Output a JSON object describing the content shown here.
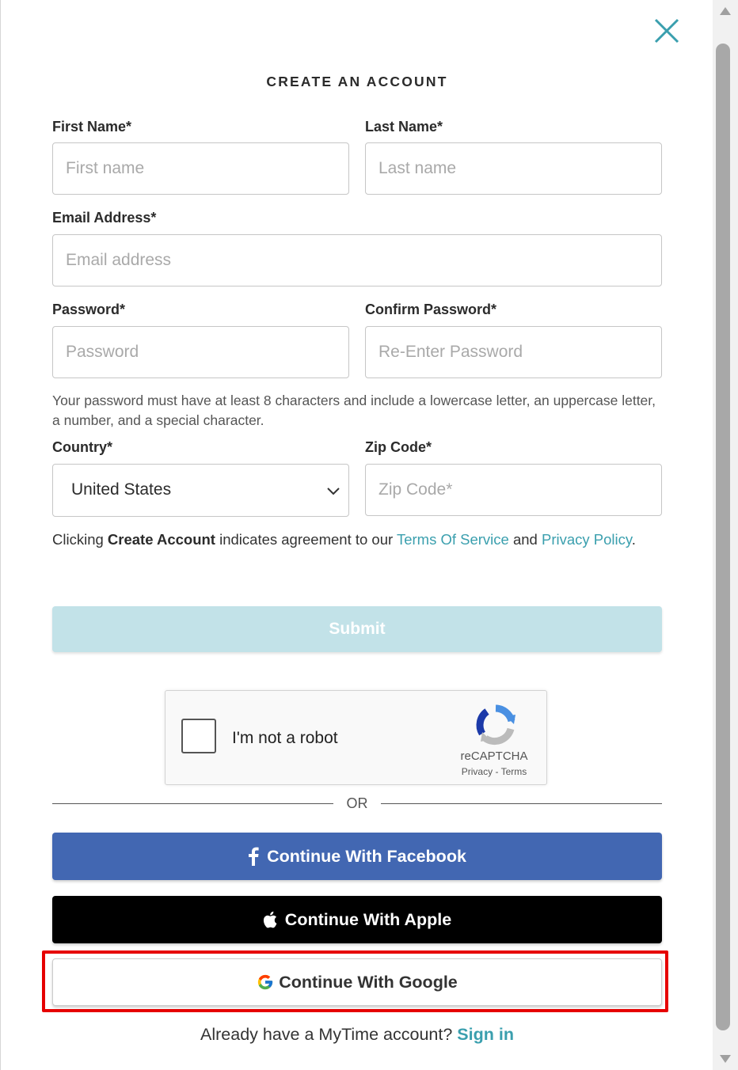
{
  "modal": {
    "title": "CREATE AN ACCOUNT",
    "close_icon": "close-icon"
  },
  "form": {
    "first_name": {
      "label": "First Name*",
      "placeholder": "First name",
      "value": ""
    },
    "last_name": {
      "label": "Last Name*",
      "placeholder": "Last name",
      "value": ""
    },
    "email": {
      "label": "Email Address*",
      "placeholder": "Email address",
      "value": ""
    },
    "password": {
      "label": "Password*",
      "placeholder": "Password",
      "value": ""
    },
    "confirm_password": {
      "label": "Confirm Password*",
      "placeholder": "Re-Enter Password",
      "value": ""
    },
    "password_hint": "Your password must have at least 8 characters and include a lowercase letter, an uppercase letter, a number, and a special character.",
    "country": {
      "label": "Country*",
      "selected": "United States"
    },
    "zip": {
      "label": "Zip Code*",
      "placeholder": "Zip Code*",
      "value": ""
    }
  },
  "terms": {
    "prefix": "Clicking ",
    "bold": "Create Account",
    "middle": " indicates agreement to our ",
    "tos_link": "Terms Of Service",
    "and": " and ",
    "privacy_link": "Privacy Policy",
    "suffix": "."
  },
  "submit_label": "Submit",
  "captcha": {
    "text": "I'm not a robot",
    "brand": "reCAPTCHA",
    "privacy": "Privacy",
    "sep": " - ",
    "terms": "Terms"
  },
  "divider_text": "OR",
  "social": {
    "facebook": "Continue With Facebook",
    "apple": "Continue With Apple",
    "google": "Continue With Google"
  },
  "signin": {
    "prompt": "Already have a MyTime account?",
    "link": "Sign in"
  },
  "colors": {
    "accent": "#3a9fae",
    "submit_disabled": "#c2e2e8",
    "facebook": "#4267b2",
    "apple": "#000000",
    "highlight": "#e60000"
  }
}
